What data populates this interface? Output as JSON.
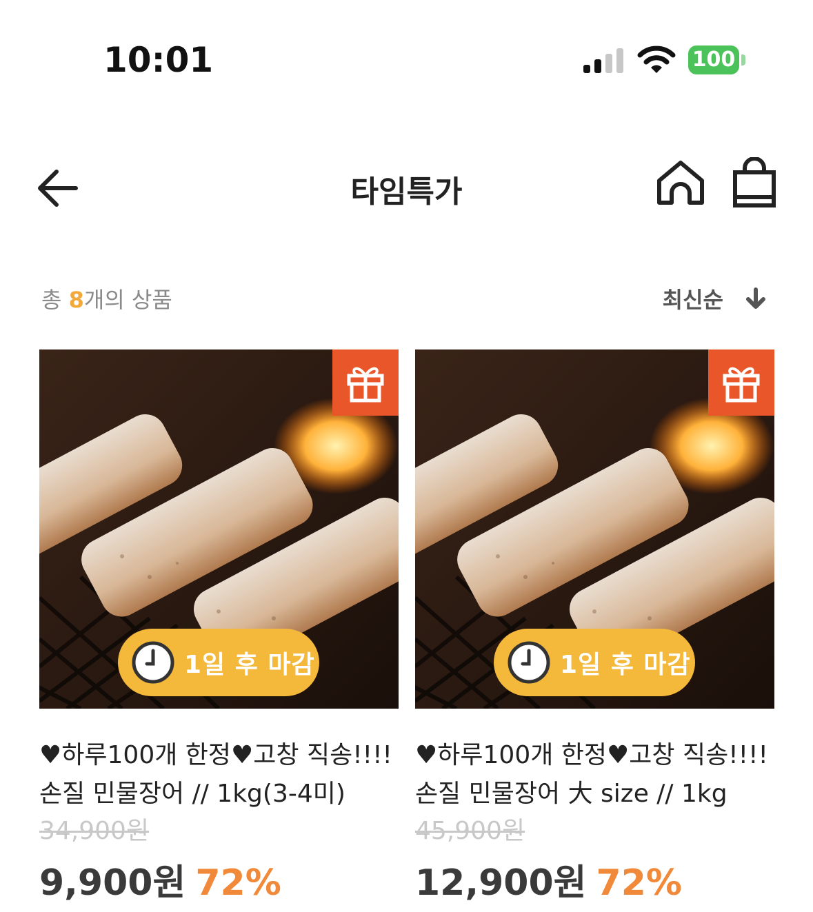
{
  "status_bar": {
    "time": "10:01",
    "battery": "100",
    "battery_color": "#4cc25a"
  },
  "nav": {
    "title": "타임특가",
    "icons": [
      "back-arrow-icon",
      "home-icon",
      "shopping-bag-icon"
    ]
  },
  "list_header": {
    "count_prefix": "총 ",
    "count_value": "8",
    "count_suffix": "개의 상품",
    "sort_label": "최신순",
    "sort_icon": "arrow-down-icon"
  },
  "products": [
    {
      "title": "♥하루100개 한정♥고창 직송!!!! 손질 민물장어 // 1kg(3-4미)",
      "original_price": "34,900원",
      "sale_price": "9,900원",
      "discount": "72%",
      "deadline": "1일 후 마감",
      "badge_icon": "gift-icon"
    },
    {
      "title": "♥하루100개 한정♥고창 직송!!!! 손질 민물장어 大 size // 1kg",
      "original_price": "45,900원",
      "sale_price": "12,900원",
      "discount": "72%",
      "deadline": "1일 후 마감",
      "badge_icon": "gift-icon"
    }
  ],
  "colors": {
    "accent_orange": "#f08a3a",
    "count_highlight": "#f2a93b",
    "gift_badge": "#e8562a",
    "deadline_pill": "#f4b83a"
  }
}
